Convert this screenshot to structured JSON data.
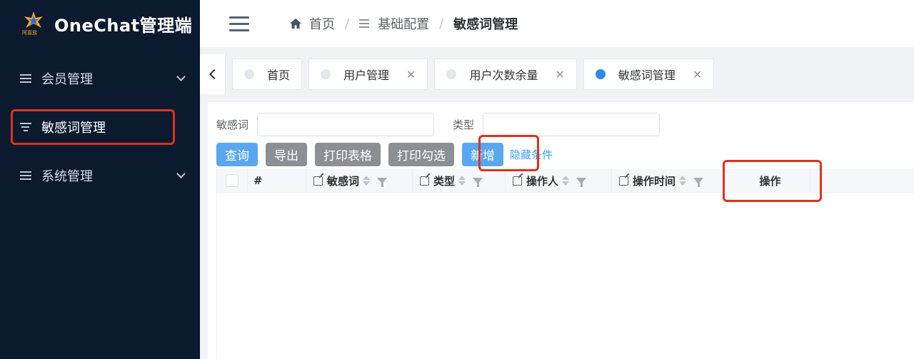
{
  "app": {
    "logo_text": "阿喜族",
    "title": "OneChat管理端"
  },
  "sidebar": {
    "items": [
      {
        "label": "会员管理"
      },
      {
        "label": "敏感词管理"
      },
      {
        "label": "系统管理"
      }
    ]
  },
  "breadcrumb": {
    "items": [
      "首页",
      "基础配置",
      "敏感词管理"
    ]
  },
  "tags": [
    {
      "label": "首页"
    },
    {
      "label": "用户管理"
    },
    {
      "label": "用户次数余量"
    },
    {
      "label": "敏感词管理"
    }
  ],
  "filters": {
    "keyword_label": "敏感词",
    "keyword_value": "",
    "type_label": "类型",
    "type_value": ""
  },
  "toolbar": {
    "query": "查询",
    "export": "导出",
    "print_table": "打印表格",
    "print_selected": "打印勾选",
    "add": "新增",
    "hide_conditions": "隐藏条件"
  },
  "table": {
    "columns": [
      "#",
      "敏感词",
      "类型",
      "操作人",
      "操作时间",
      "操作"
    ],
    "rows": []
  },
  "colors": {
    "sidebar_bg": "#0c1a30",
    "primary": "#5aa7ef",
    "highlight": "#e0311d",
    "active_dot": "#2e88f0"
  }
}
